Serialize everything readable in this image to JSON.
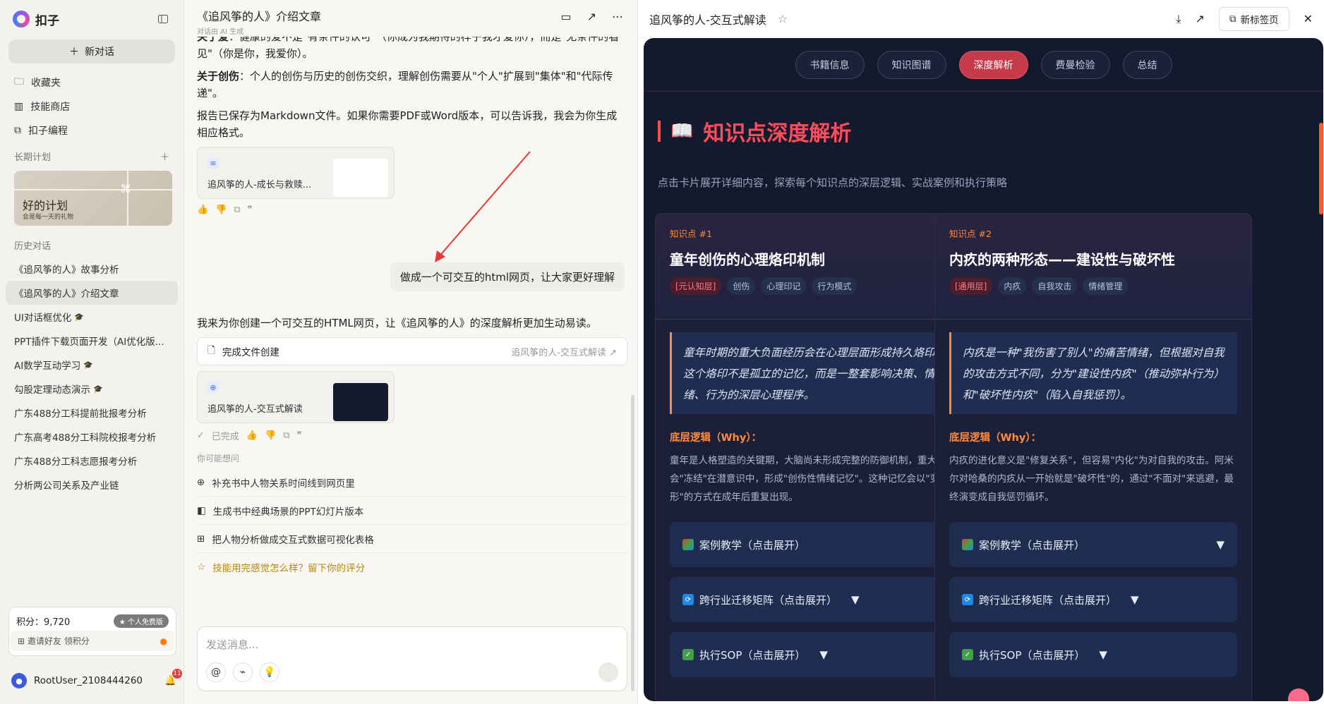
{
  "sidebar": {
    "app_name": "扣子",
    "new_chat": "新对话",
    "nav": [
      {
        "label": "收藏夹",
        "icon": "folder-icon"
      },
      {
        "label": "技能商店",
        "icon": "store-icon"
      },
      {
        "label": "扣子编程",
        "icon": "code-icon"
      }
    ],
    "plan_title": "长期计划",
    "plan_card": {
      "title": "好的计划",
      "subtitle": "会是每一天的礼物"
    },
    "history_title": "历史对话",
    "history": [
      {
        "label": "《追风筝的人》故事分析",
        "cap": ""
      },
      {
        "label": "《追风筝的人》介绍文章",
        "cap": ""
      },
      {
        "label": "UI对话框优化",
        "cap": "🎓"
      },
      {
        "label": "PPT插件下载页面开发（AI优化版...",
        "cap": ""
      },
      {
        "label": "AI数学互动学习",
        "cap": "🎓"
      },
      {
        "label": "勾股定理动态演示",
        "cap": "🎓"
      },
      {
        "label": "广东488分工科提前批报考分析",
        "cap": ""
      },
      {
        "label": "广东高考488分工科院校报考分析",
        "cap": ""
      },
      {
        "label": "广东488分工科志愿报考分析",
        "cap": ""
      },
      {
        "label": "分析两公司关系及产业链",
        "cap": ""
      }
    ],
    "points_label": "积分：9,720",
    "badge": "个人免费版",
    "invite": "邀请好友 领积分",
    "user": "RootUser_2108444260",
    "notifications": "11"
  },
  "chat": {
    "title": "《追风筝的人》介绍文章",
    "subtitle": "对话由 AI 生成",
    "p1_bold": "关于爱",
    "p1": "：健康的爱不是\"有条件的认可\"（你成为我期待的样子我才爱你），而是\"无条件的看见\"（你是你，我爱你）。",
    "p2_bold": "关于创伤",
    "p2": "：个人的创伤与历史的创伤交织，理解创伤需要从\"个人\"扩展到\"集体\"和\"代际传递\"。",
    "p3": "报告已保存为Markdown文件。如果你需要PDF或Word版本，可以告诉我，我会为你生成相应格式。",
    "file1": "追风筝的人-成长与救赎...",
    "user_msg": "做成一个可交互的html网页，让大家更好理解",
    "reply": "我来为你创建一个可交互的HTML网页，让《追风筝的人》的深度解析更加生动易读。",
    "done_label": "完成文件创建",
    "done_link": "追风筝的人-交互式解读",
    "file2": "追风筝的人-交互式解读",
    "status": "已完成",
    "suggest_title": "你可能想问",
    "suggestions": [
      "补充书中人物关系时间线到网页里",
      "生成书中经典场景的PPT幻灯片版本",
      "把人物分析做成交互式数据可视化表格"
    ],
    "rate": "技能用完感觉怎么样？留下你的评分",
    "placeholder": "发送消息..."
  },
  "preview": {
    "title": "追风筝的人-交互式解读",
    "new_tab": "新标签页",
    "tabs": [
      "书籍信息",
      "知识图谱",
      "深度解析",
      "费曼检验",
      "总结"
    ],
    "active_tab": 2,
    "heading": "知识点深度解析",
    "heading_icon": "📖",
    "subheading": "点击卡片展开详细内容，探索每个知识点的深层逻辑、实战案例和执行策略",
    "cards": [
      {
        "kp": "知识点 #1",
        "title": "童年创伤的心理烙印机制",
        "tags": [
          "[元认知层]",
          "创伤",
          "心理印记",
          "行为模式"
        ],
        "quote": "童年时期的重大负面经历会在心理层面形成持久烙印，这个烙印不是孤立的记忆，而是一整套影响决策、情绪、行为的深层心理程序。",
        "why": "底层逻辑（Why）：",
        "why_text": "童年是人格塑造的关键期，大脑尚未形成完整的防御机制，重大创伤会\"冻结\"在潜意识中，形成\"创伤性情绪记忆\"。这种记忆会以\"变形\"的方式在成年后重复出现。",
        "acc": [
          "案例教学（点击展开）",
          "跨行业迁移矩阵（点击展开）",
          "执行SOP（点击展开）"
        ]
      },
      {
        "kp": "知识点 #2",
        "title": "内疚的两种形态——建设性与破坏性",
        "tags": [
          "[通用层]",
          "内疚",
          "自我攻击",
          "情绪管理"
        ],
        "quote": "内疚是一种\"我伤害了别人\"的痛苦情绪，但根据对自我的攻击方式不同，分为\"建设性内疚\"（推动弥补行为）和\"破坏性内疚\"（陷入自我惩罚）。",
        "why": "底层逻辑（Why）：",
        "why_text": "内疚的进化意义是\"修复关系\"，但容易\"内化\"为对自我的攻击。阿米尔对哈桑的内疚从一开始就是\"破坏性\"的，通过\"不面对\"来逃避，最终演变成自我惩罚循环。",
        "acc": [
          "案例教学（点击展开）",
          "跨行业迁移矩阵（点击展开）",
          "执行SOP（点击展开）"
        ]
      }
    ],
    "arrow": "▼",
    "colors": {
      "page_bg": "#141a2e",
      "accent": "#ff4d5e",
      "orange": "#ff8a3d"
    }
  }
}
